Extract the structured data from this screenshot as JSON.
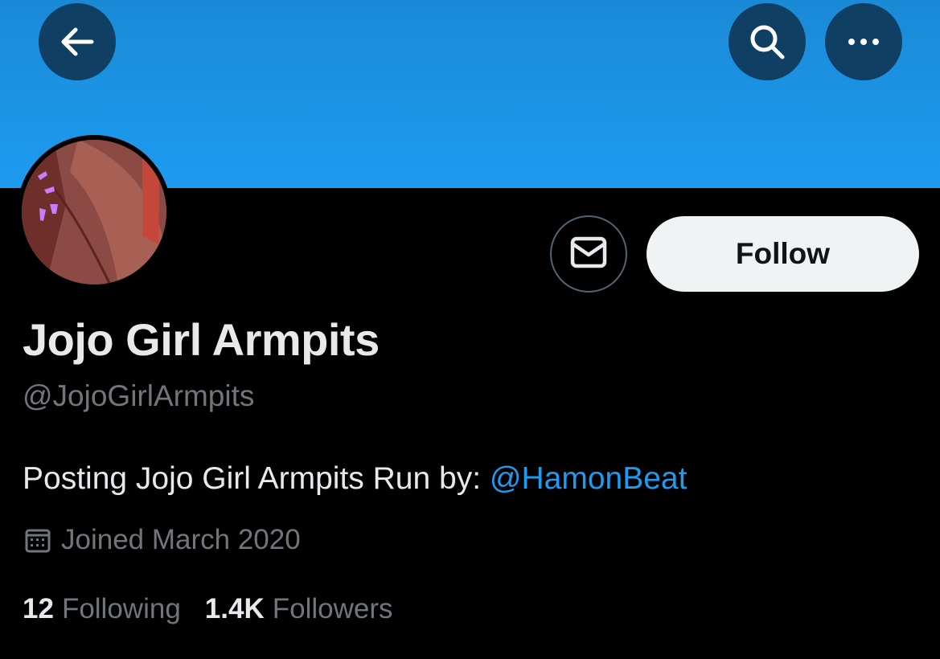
{
  "header": {
    "back_icon": "arrow-left-icon",
    "search_icon": "search-icon",
    "more_icon": "more-horizontal-icon",
    "banner_color": "#1d9bf0"
  },
  "profile": {
    "display_name": "Jojo Girl Armpits",
    "handle": "@JojoGirlArmpits",
    "bio_text": "Posting Jojo Girl Armpits Run by: ",
    "bio_mention": "@HamonBeat",
    "joined": "Joined March 2020",
    "message_icon": "envelope-icon",
    "follow_label": "Follow",
    "link_color": "#1d9bf0"
  },
  "stats": {
    "following_count": "12",
    "following_label": "Following",
    "followers_count": "1.4K",
    "followers_label": "Followers"
  }
}
